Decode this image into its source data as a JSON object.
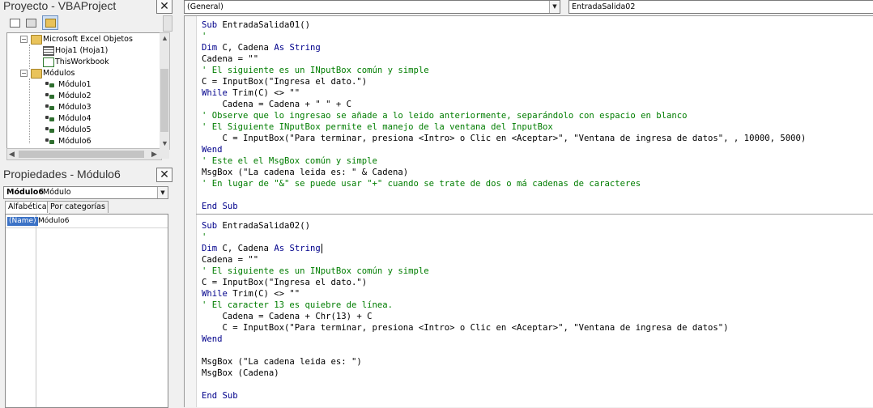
{
  "project_pane": {
    "title": "Proyecto - VBAProject",
    "close": "✕",
    "tree": [
      {
        "label": "Microsoft Excel Objetos",
        "icon": "folder-icon",
        "expander": "−"
      },
      {
        "label": "Hoja1 (Hoja1)",
        "icon": "worksheet-icon"
      },
      {
        "label": "ThisWorkbook",
        "icon": "workbook-icon"
      },
      {
        "label": "Módulos",
        "icon": "folder-icon",
        "expander": "−"
      },
      {
        "label": "Módulo1",
        "icon": "module-icon"
      },
      {
        "label": "Módulo2",
        "icon": "module-icon"
      },
      {
        "label": "Módulo3",
        "icon": "module-icon"
      },
      {
        "label": "Módulo4",
        "icon": "module-icon"
      },
      {
        "label": "Módulo5",
        "icon": "module-icon"
      },
      {
        "label": "Módulo6",
        "icon": "module-icon"
      }
    ]
  },
  "properties_pane": {
    "title": "Propiedades - Módulo6",
    "close": "✕",
    "object_name": "Módulo6",
    "object_type": "Módulo",
    "tabs": [
      "Alfabética",
      "Por categorías"
    ],
    "active_tab": "Alfabética",
    "properties": [
      {
        "key": "(Name)",
        "value": "Módulo6"
      }
    ]
  },
  "code_window": {
    "object_combo": "(General)",
    "procedure_combo": "EntradaSalida02",
    "colors": {
      "keyword": "#00008b",
      "comment": "#007d00",
      "text": "#000000"
    },
    "procedures": [
      {
        "lines": [
          [
            {
              "t": "Sub",
              "c": "kw"
            },
            {
              "t": " EntradaSalida01()"
            }
          ],
          [
            {
              "t": "'",
              "c": "cm"
            }
          ],
          [
            {
              "t": "Dim",
              "c": "kw"
            },
            {
              "t": " C, Cadena "
            },
            {
              "t": "As",
              "c": "kw"
            },
            {
              "t": " "
            },
            {
              "t": "String",
              "c": "kw"
            }
          ],
          [
            {
              "t": "Cadena = \"\""
            }
          ],
          [
            {
              "t": "' El siguiente es un INputBox común y simple",
              "c": "cm"
            }
          ],
          [
            {
              "t": "C = InputBox(\"Ingresa el dato.\")"
            }
          ],
          [
            {
              "t": "While",
              "c": "kw"
            },
            {
              "t": " Trim(C) <> \"\""
            }
          ],
          [
            {
              "t": "    Cadena = Cadena + \" \" + C"
            }
          ],
          [
            {
              "t": "' Observe que lo ingresao se añade a lo leido anteriormente, separándolo con espacio en blanco",
              "c": "cm"
            }
          ],
          [
            {
              "t": "' El Siguiente INputBox permite el manejo de la ventana del InputBox",
              "c": "cm"
            }
          ],
          [
            {
              "t": "    C = InputBox(\"Para terminar, presiona <Intro> o Clic en <Aceptar>\", \"Ventana de ingresa de datos\", , 10000, 5000)"
            }
          ],
          [
            {
              "t": "Wend",
              "c": "kw"
            }
          ],
          [
            {
              "t": "' Este el el MsgBox común y simple",
              "c": "cm"
            }
          ],
          [
            {
              "t": "MsgBox (\"La cadena leida es: \" & Cadena)"
            }
          ],
          [
            {
              "t": "' En lugar de \"&\" se puede usar \"+\" cuando se trate de dos o má cadenas de caracteres",
              "c": "cm"
            }
          ],
          [],
          [
            {
              "t": "End",
              "c": "kw"
            },
            {
              "t": " "
            },
            {
              "t": "Sub",
              "c": "kw"
            }
          ]
        ]
      },
      {
        "lines": [
          [
            {
              "t": "Sub",
              "c": "kw"
            },
            {
              "t": " EntradaSalida02()"
            }
          ],
          [
            {
              "t": "'",
              "c": "cm"
            }
          ],
          [
            {
              "t": "Dim",
              "c": "kw"
            },
            {
              "t": " C, Cadena "
            },
            {
              "t": "As",
              "c": "kw"
            },
            {
              "t": " "
            },
            {
              "t": "String",
              "c": "kw"
            }
          ],
          [
            {
              "t": "Cadena = \"\""
            }
          ],
          [
            {
              "t": "' El siguiente es un INputBox común y simple",
              "c": "cm"
            }
          ],
          [
            {
              "t": "C = InputBox(\"Ingresa el dato.\")"
            }
          ],
          [
            {
              "t": "While",
              "c": "kw"
            },
            {
              "t": " Trim(C) <> \"\""
            }
          ],
          [
            {
              "t": "' El caracter 13 es quiebre de línea.",
              "c": "cm"
            }
          ],
          [
            {
              "t": "    Cadena = Cadena + Chr(13) + C"
            }
          ],
          [
            {
              "t": "    C = InputBox(\"Para terminar, presiona <Intro> o Clic en <Aceptar>\", \"Ventana de ingresa de datos\")"
            }
          ],
          [
            {
              "t": "Wend",
              "c": "kw"
            }
          ],
          [],
          [
            {
              "t": "MsgBox (\"La cadena leida es: \")"
            }
          ],
          [
            {
              "t": "MsgBox (Cadena)"
            }
          ],
          [],
          [
            {
              "t": "End",
              "c": "kw"
            },
            {
              "t": " "
            },
            {
              "t": "Sub",
              "c": "kw"
            }
          ]
        ]
      }
    ]
  }
}
